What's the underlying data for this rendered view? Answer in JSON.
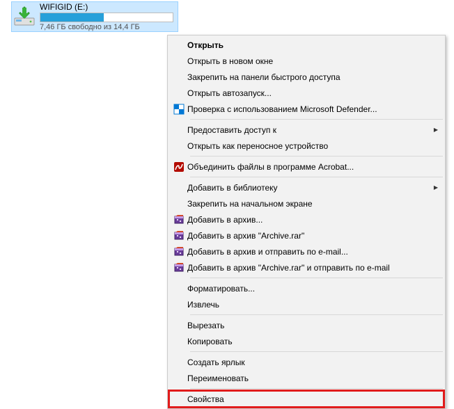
{
  "drive": {
    "name": "WIFIGID (E:)",
    "storage_line": "7,46 ГБ свободно из 14,4 ГБ",
    "fill_percent": 48
  },
  "menu": {
    "items": [
      {
        "label": "Открыть",
        "bold": true
      },
      {
        "label": "Открыть в новом окне"
      },
      {
        "label": "Закрепить на панели быстрого доступа"
      },
      {
        "label": "Открыть автозапуск..."
      },
      {
        "label": "Проверка с использованием Microsoft Defender...",
        "icon": "defender"
      },
      {
        "sep": true
      },
      {
        "label": "Предоставить доступ к",
        "submenu": true
      },
      {
        "label": "Открыть как переносное устройство"
      },
      {
        "sep": true
      },
      {
        "label": "Объединить файлы в программе Acrobat...",
        "icon": "acrobat"
      },
      {
        "sep": true
      },
      {
        "label": "Добавить в библиотеку",
        "submenu": true
      },
      {
        "label": "Закрепить на начальном экране"
      },
      {
        "label": "Добавить в архив...",
        "icon": "winrar"
      },
      {
        "label": "Добавить в архив \"Archive.rar\"",
        "icon": "winrar"
      },
      {
        "label": "Добавить в архив и отправить по e-mail...",
        "icon": "winrar"
      },
      {
        "label": "Добавить в архив \"Archive.rar\" и отправить по e-mail",
        "icon": "winrar"
      },
      {
        "sep": true
      },
      {
        "label": "Форматировать..."
      },
      {
        "label": "Извлечь"
      },
      {
        "sep": true
      },
      {
        "label": "Вырезать"
      },
      {
        "label": "Копировать"
      },
      {
        "sep": true
      },
      {
        "label": "Создать ярлык"
      },
      {
        "label": "Переименовать"
      },
      {
        "sep": true
      },
      {
        "label": "Свойства",
        "highlight": true
      }
    ]
  },
  "icons": {
    "defender": "defender-icon",
    "acrobat": "acrobat-icon",
    "winrar": "winrar-icon",
    "chevron": "›"
  }
}
